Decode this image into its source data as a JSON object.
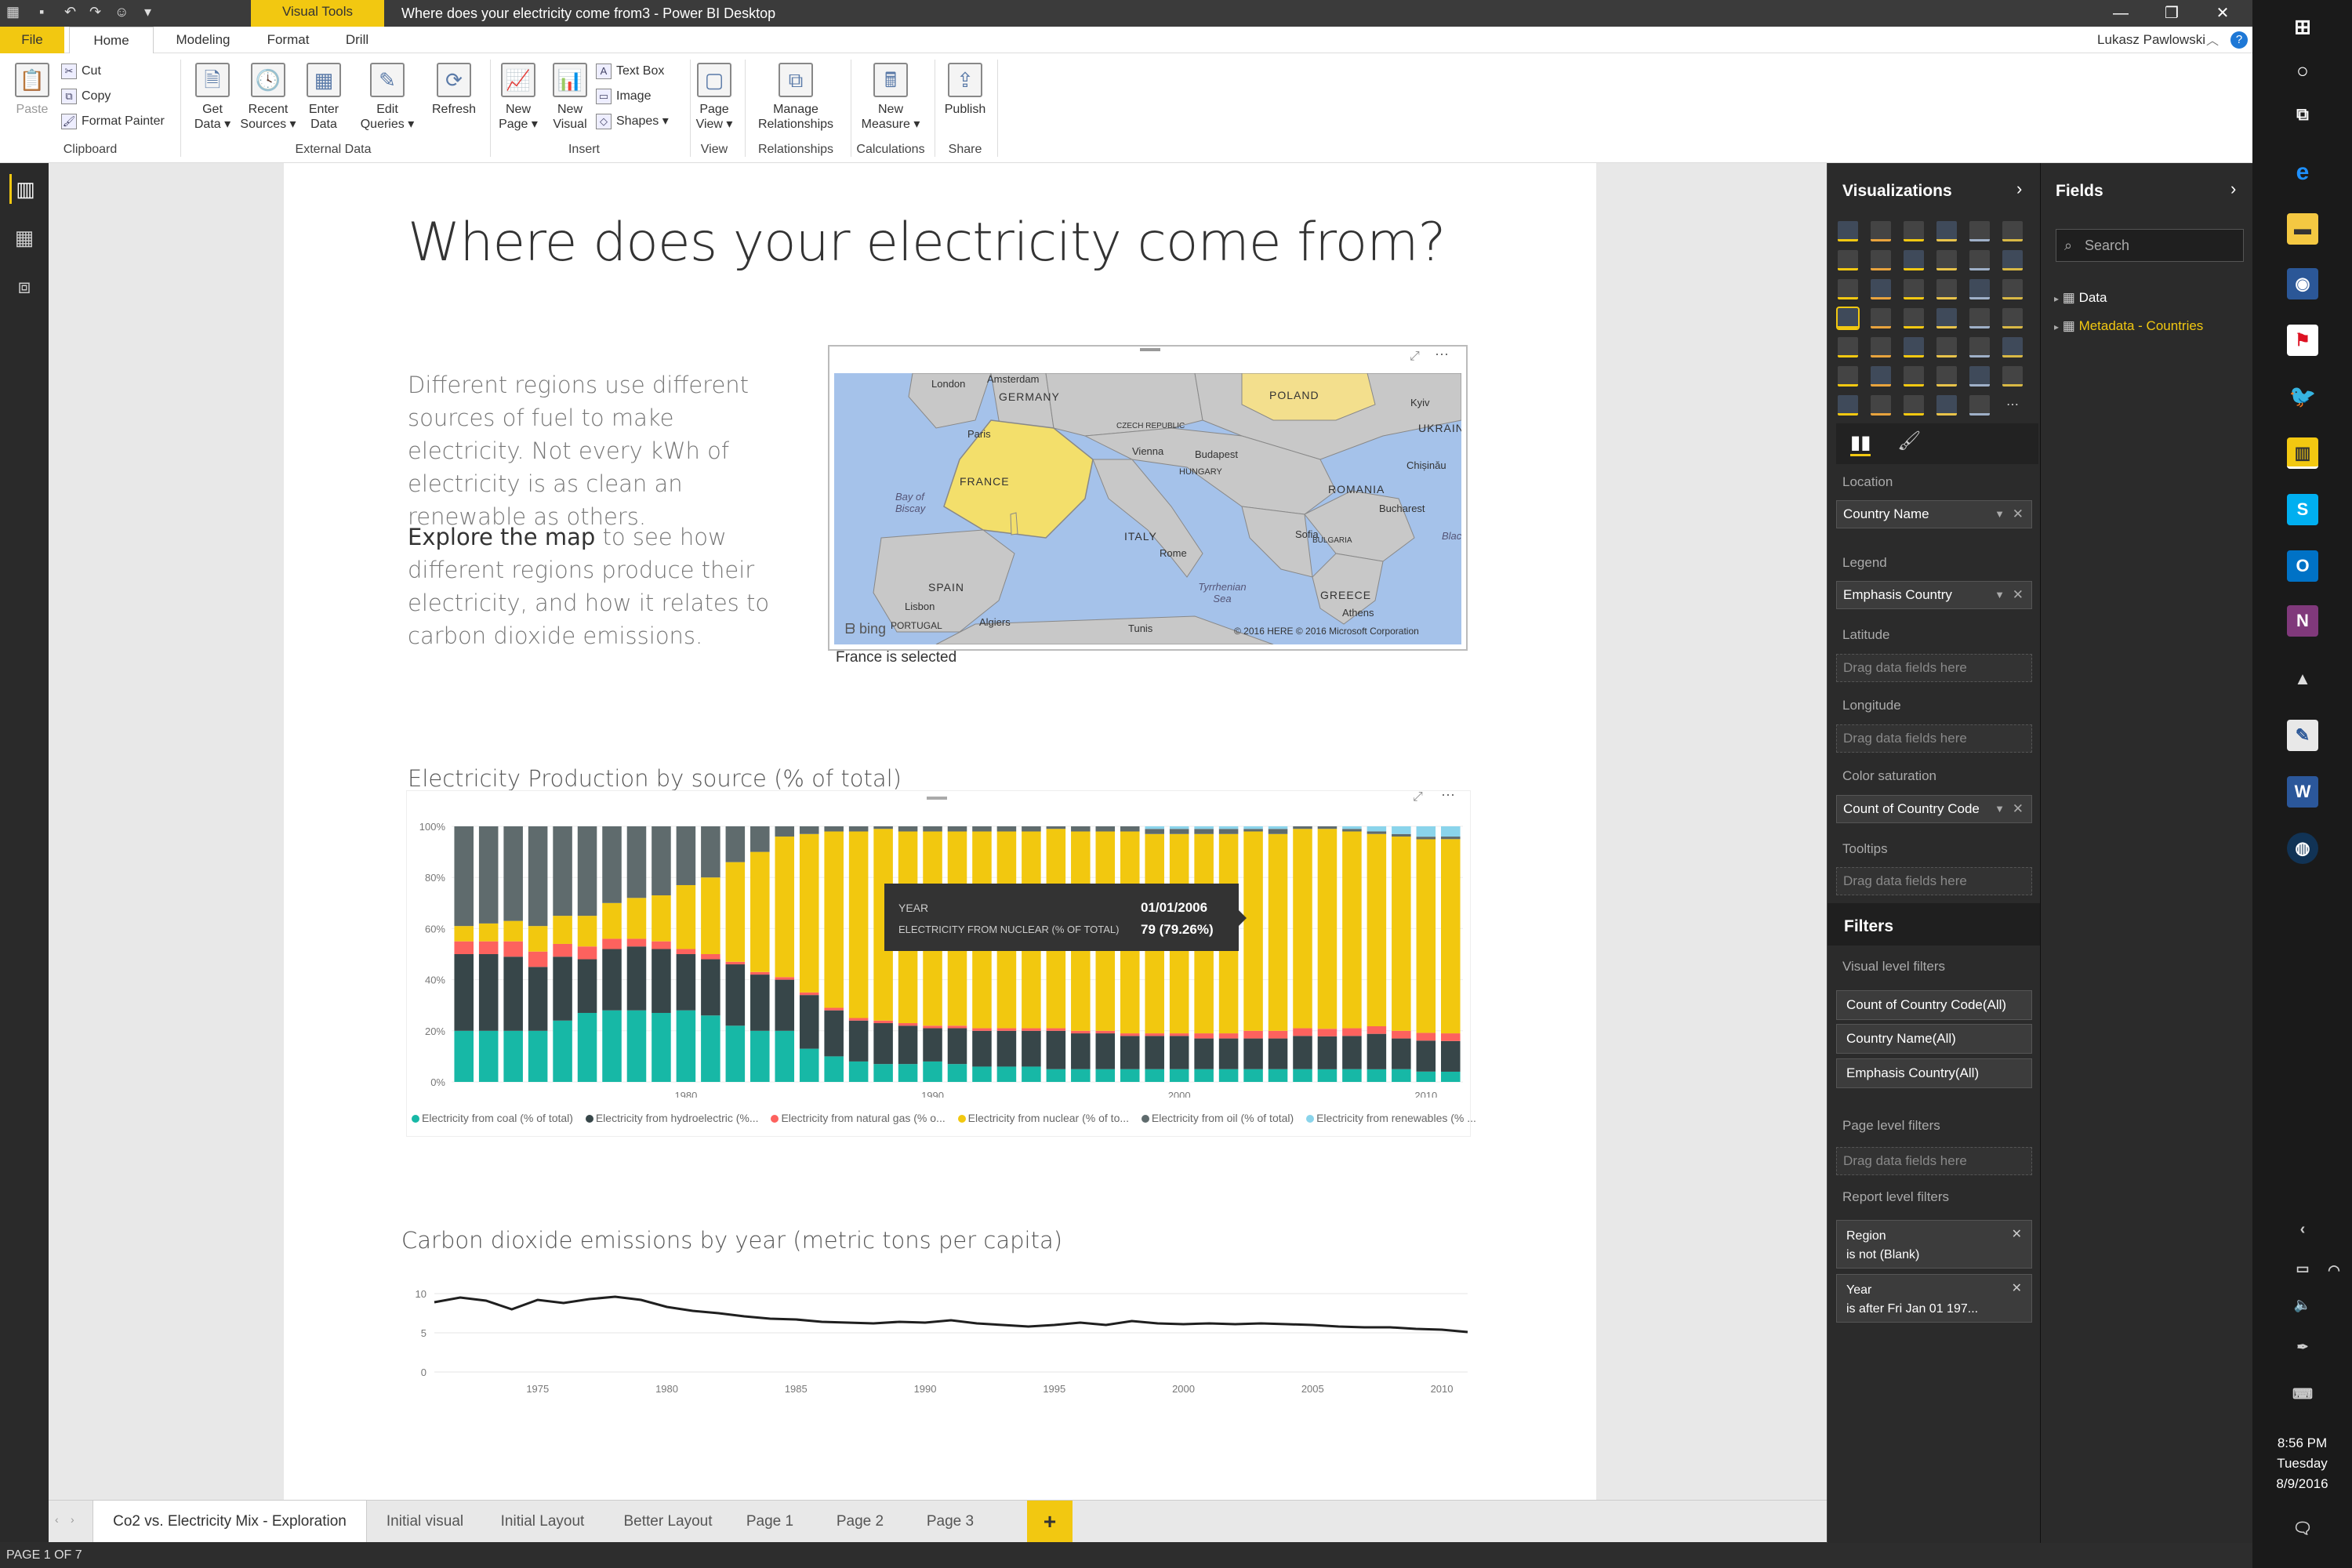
{
  "app": {
    "window_title": "Where does your electricity come from3 - Power BI Desktop",
    "context_tab": "Visual Tools",
    "user": "Lukasz Pawlowski"
  },
  "ribbon": {
    "tabs": [
      "File",
      "Home",
      "Modeling",
      "Format",
      "Drill"
    ],
    "clipboard": {
      "paste": "Paste",
      "cut": "Cut",
      "copy": "Copy",
      "format_painter": "Format Painter",
      "group": "Clipboard"
    },
    "external": {
      "get_data": "Get Data",
      "recent_sources": "Recent Sources",
      "enter_data": "Enter Data",
      "edit_queries": "Edit Queries",
      "refresh": "Refresh",
      "group": "External Data"
    },
    "insert": {
      "new_page": "New Page",
      "new_visual": "New Visual",
      "text_box": "Text Box",
      "image": "Image",
      "shapes": "Shapes",
      "group": "Insert"
    },
    "view": {
      "page_view": "Page View",
      "group": "View"
    },
    "relationships": {
      "manage": "Manage Relationships",
      "group": "Relationships"
    },
    "calculations": {
      "new_measure": "New Measure",
      "group": "Calculations"
    },
    "share": {
      "publish": "Publish",
      "group": "Share"
    }
  },
  "report": {
    "title": "Where does your electricity come from?",
    "intro1": "Different regions use different sources of fuel to make electricity. Not every kWh of electricity is as clean an renewable as others.",
    "intro2_bold": "Explore the map",
    "intro2_rest": " to see how different regions produce their electricity, and how it relates to carbon dioxide emissions.",
    "map_caption": "France is selected",
    "map_labels": {
      "london": "London",
      "amsterdam": "Amsterdam",
      "germany": "GERMANY",
      "poland": "POLAND",
      "kyiv": "Kyiv",
      "ukraine": "UKRAIN",
      "paris": "Paris",
      "france": "FRANCE",
      "bay": "Bay of Biscay",
      "czech": "CZECH REPUBLIC",
      "vienna": "Vienna",
      "budapest": "Budapest",
      "hungary": "HUNGARY",
      "romania": "ROMANIA",
      "bucharest": "Bucharest",
      "chisinau": "Chișinău",
      "italy": "ITALY",
      "rome": "Rome",
      "sofia": "Sofia",
      "bulgaria": "BULGARIA",
      "spain": "SPAIN",
      "portugal": "PORTUGAL",
      "lisbon": "Lisbon",
      "greece": "GREECE",
      "athens": "Athens",
      "algiers": "Algiers",
      "tunis": "Tunis",
      "tyrrhenian": "Tyrrhenian Sea",
      "black": "Blac",
      "bing": "bing",
      "copyright": "© 2016 HERE  © 2016 Microsoft Corporation"
    },
    "c1_title": "Electricity Production by source (% of total)",
    "c2_title": "Carbon dioxide emissions by year (metric tons per capita)",
    "tooltip": {
      "k1": "YEAR",
      "v1": "01/01/2006",
      "k2": "ELECTRICITY FROM NUCLEAR (% OF TOTAL)",
      "v2": "79 (79.26%)"
    }
  },
  "chart_data": [
    {
      "type": "bar",
      "stacked": true,
      "title": "Electricity Production by source (% of total)",
      "categories": [
        1971,
        1972,
        1973,
        1974,
        1975,
        1976,
        1977,
        1978,
        1979,
        1980,
        1981,
        1982,
        1983,
        1984,
        1985,
        1986,
        1987,
        1988,
        1989,
        1990,
        1991,
        1992,
        1993,
        1994,
        1995,
        1996,
        1997,
        1998,
        1999,
        2000,
        2001,
        2002,
        2003,
        2004,
        2005,
        2006,
        2007,
        2008,
        2009,
        2010,
        2011
      ],
      "ylim": [
        0,
        100
      ],
      "yticks": [
        "0%",
        "20%",
        "40%",
        "60%",
        "80%",
        "100%"
      ],
      "xticks": [
        "1980",
        "1990",
        "2000",
        "2010"
      ],
      "colors": [
        "#17b8a6",
        "#374649",
        "#fd625e",
        "#f2c80f",
        "#5f6b6d",
        "#8ad4eb"
      ],
      "series": [
        {
          "name": "Electricity from coal (% of total)",
          "values": [
            20,
            20,
            20,
            20,
            24,
            27,
            28,
            28,
            27,
            28,
            26,
            22,
            20,
            20,
            13,
            10,
            8,
            7,
            7,
            8,
            7,
            6,
            6,
            6,
            5,
            5,
            5,
            5,
            5,
            5,
            5,
            5,
            5,
            5,
            5,
            5,
            5,
            5,
            5,
            4,
            4
          ]
        },
        {
          "name": "Electricity from hydroelectric (%...",
          "values": [
            30,
            30,
            29,
            25,
            25,
            21,
            24,
            25,
            25,
            22,
            22,
            24,
            22,
            20,
            21,
            18,
            16,
            16,
            15,
            13,
            14,
            14,
            14,
            14,
            15,
            14,
            14,
            13,
            13,
            13,
            12,
            12,
            12,
            12,
            13,
            13,
            13,
            14,
            12,
            12,
            12
          ]
        },
        {
          "name": "Electricity from natural gas (% o...",
          "values": [
            5,
            5,
            6,
            6,
            5,
            5,
            4,
            3,
            3,
            2,
            2,
            1,
            1,
            1,
            1,
            1,
            1,
            1,
            1,
            1,
            1,
            1,
            1,
            1,
            1,
            1,
            1,
            1,
            1,
            1,
            2,
            2,
            3,
            3,
            3,
            3,
            3,
            3,
            3,
            3,
            3
          ]
        },
        {
          "name": "Electricity from nuclear (% of to...",
          "values": [
            6,
            7,
            8,
            10,
            11,
            12,
            14,
            16,
            18,
            25,
            30,
            39,
            47,
            55,
            62,
            69,
            73,
            75,
            75,
            76,
            76,
            77,
            77,
            77,
            78,
            78,
            78,
            79,
            78,
            78,
            78,
            78,
            78,
            77,
            78,
            79,
            77,
            76,
            76,
            75,
            76
          ]
        },
        {
          "name": "Electricity from oil (% of total)",
          "values": [
            39,
            38,
            37,
            39,
            35,
            35,
            30,
            28,
            27,
            23,
            20,
            14,
            10,
            4,
            3,
            2,
            2,
            1,
            2,
            2,
            2,
            2,
            2,
            2,
            1,
            2,
            2,
            2,
            2,
            2,
            2,
            2,
            1,
            2,
            1,
            1,
            1,
            1,
            1,
            1,
            1
          ]
        },
        {
          "name": "Electricity from renewables (% ...",
          "values": [
            0,
            0,
            0,
            0,
            0,
            0,
            0,
            0,
            0,
            0,
            0,
            0,
            0,
            0,
            0,
            0,
            0,
            0,
            0,
            0,
            0,
            0,
            0,
            0,
            0,
            0,
            0,
            0,
            1,
            1,
            1,
            1,
            1,
            1,
            0,
            0,
            1,
            2,
            3,
            4,
            4
          ]
        }
      ]
    },
    {
      "type": "line",
      "title": "Carbon dioxide emissions by year (metric tons per capita)",
      "x": [
        1971,
        1972,
        1973,
        1974,
        1975,
        1976,
        1977,
        1978,
        1979,
        1980,
        1981,
        1982,
        1983,
        1984,
        1985,
        1986,
        1987,
        1988,
        1989,
        1990,
        1991,
        1992,
        1993,
        1994,
        1995,
        1996,
        1997,
        1998,
        1999,
        2000,
        2001,
        2002,
        2003,
        2004,
        2005,
        2006,
        2007,
        2008,
        2009,
        2010,
        2011
      ],
      "values": [
        8.9,
        9.5,
        9.1,
        8.0,
        9.2,
        8.8,
        9.3,
        9.6,
        9.2,
        8.3,
        7.8,
        7.5,
        7.1,
        6.8,
        6.7,
        6.4,
        6.3,
        6.2,
        6.4,
        6.3,
        6.6,
        6.2,
        6.0,
        5.8,
        6.0,
        6.3,
        6.0,
        6.5,
        6.2,
        6.1,
        6.2,
        6.1,
        6.2,
        6.1,
        6.0,
        5.8,
        5.7,
        5.7,
        5.5,
        5.4,
        5.1
      ],
      "ylim": [
        0,
        10
      ],
      "yticks": [
        "0",
        "5",
        "10"
      ],
      "xticks": [
        "1975",
        "1980",
        "1985",
        "1990",
        "1995",
        "2000",
        "2005",
        "2010"
      ],
      "color": "#1f1f1f"
    }
  ],
  "page_tabs": [
    "Co2 vs. Electricity Mix - Exploration",
    "Initial visual",
    "Initial Layout",
    "Better Layout",
    "Page 1",
    "Page 2",
    "Page 3"
  ],
  "add_page": "+",
  "status": "PAGE 1 OF 7",
  "viz_pane": {
    "title": "Visualizations",
    "wells": {
      "location_label": "Location",
      "location_value": "Country Name",
      "legend_label": "Legend",
      "legend_value": "Emphasis Country",
      "latitude_label": "Latitude",
      "longitude_label": "Longitude",
      "color_sat_label": "Color saturation",
      "color_sat_value": "Count of Country Code",
      "tooltips_label": "Tooltips",
      "empty": "Drag data fields here"
    },
    "filters": {
      "title": "Filters",
      "visual_level": "Visual level filters",
      "f1": "Count of Country Code(All)",
      "f2": "Country Name(All)",
      "f3": "Emphasis Country(All)",
      "page_level": "Page level filters",
      "report_level": "Report level filters",
      "r1_name": "Region",
      "r1_cond": "is not (Blank)",
      "r2_name": "Year",
      "r2_cond": "is after Fri Jan 01 197..."
    }
  },
  "fields_pane": {
    "title": "Fields",
    "search_placeholder": "Search",
    "tables": [
      "Data",
      "Metadata - Countries"
    ]
  },
  "taskbar": {
    "time": "8:56 PM",
    "day": "Tuesday",
    "date": "8/9/2016"
  }
}
